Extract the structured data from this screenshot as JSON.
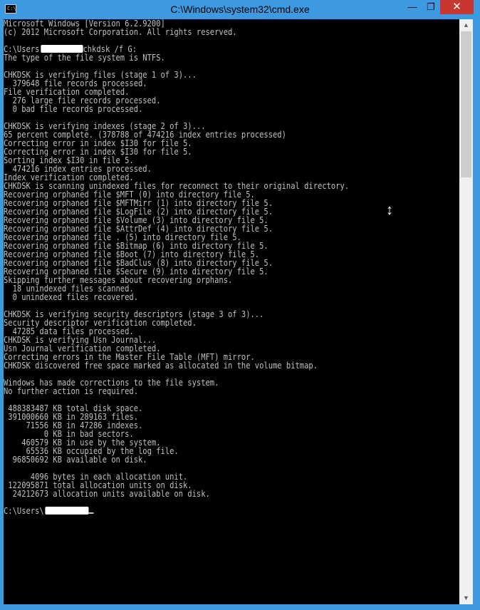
{
  "window": {
    "title": "C:\\Windows\\system32\\cmd.exe",
    "icon_name": "console-app-icon",
    "icon_label": "C:\\",
    "minimize_symbol": "—",
    "maximize_symbol": "❐",
    "close_symbol": "✕"
  },
  "console": {
    "lines": [
      {
        "text": "Microsoft Windows [Version 6.2.9200]"
      },
      {
        "text": "(c) 2012 Microsoft Corporation. All rights reserved."
      },
      {
        "text": ""
      },
      {
        "text": "C:\\Users",
        "redacted": true,
        "after": "chkdsk /f G:"
      },
      {
        "text": "The type of the file system is NTFS."
      },
      {
        "text": ""
      },
      {
        "text": "CHKDSK is verifying files (stage 1 of 3)..."
      },
      {
        "text": "  379648 file records processed."
      },
      {
        "text": "File verification completed."
      },
      {
        "text": "  276 large file records processed."
      },
      {
        "text": "  0 bad file records processed."
      },
      {
        "text": ""
      },
      {
        "text": "CHKDSK is verifying indexes (stage 2 of 3)..."
      },
      {
        "text": "65 percent complete. (378788 of 474216 index entries processed)"
      },
      {
        "text": "Correcting error in index $I30 for file 5."
      },
      {
        "text": "Correcting error in index $I30 for file 5."
      },
      {
        "text": "Sorting index $I30 in file 5."
      },
      {
        "text": "  474216 index entries processed."
      },
      {
        "text": "Index verification completed."
      },
      {
        "text": "CHKDSK is scanning unindexed files for reconnect to their original directory."
      },
      {
        "text": "Recovering orphaned file $MFT (0) into directory file 5."
      },
      {
        "text": "Recovering orphaned file $MFTMirr (1) into directory file 5."
      },
      {
        "text": "Recovering orphaned file $LogFile (2) into directory file 5."
      },
      {
        "text": "Recovering orphaned file $Volume (3) into directory file 5."
      },
      {
        "text": "Recovering orphaned file $AttrDef (4) into directory file 5."
      },
      {
        "text": "Recovering orphaned file . (5) into directory file 5."
      },
      {
        "text": "Recovering orphaned file $Bitmap (6) into directory file 5."
      },
      {
        "text": "Recovering orphaned file $Boot (7) into directory file 5."
      },
      {
        "text": "Recovering orphaned file $BadClus (8) into directory file 5."
      },
      {
        "text": "Recovering orphaned file $Secure (9) into directory file 5."
      },
      {
        "text": "Skipping further messages about recovering orphans."
      },
      {
        "text": "  18 unindexed files scanned."
      },
      {
        "text": "  0 unindexed files recovered."
      },
      {
        "text": ""
      },
      {
        "text": "CHKDSK is verifying security descriptors (stage 3 of 3)..."
      },
      {
        "text": "Security descriptor verification completed."
      },
      {
        "text": "  47285 data files processed."
      },
      {
        "text": "CHKDSK is verifying Usn Journal..."
      },
      {
        "text": "Usn Journal verification completed."
      },
      {
        "text": "Correcting errors in the Master File Table (MFT) mirror."
      },
      {
        "text": "CHKDSK discovered free space marked as allocated in the volume bitmap."
      },
      {
        "text": ""
      },
      {
        "text": "Windows has made corrections to the file system."
      },
      {
        "text": "No further action is required."
      },
      {
        "text": ""
      },
      {
        "text": " 488383487 KB total disk space."
      },
      {
        "text": " 391000660 KB in 289163 files."
      },
      {
        "text": "     71556 KB in 47286 indexes."
      },
      {
        "text": "         0 KB in bad sectors."
      },
      {
        "text": "    460579 KB in use by the system."
      },
      {
        "text": "     65536 KB occupied by the log file."
      },
      {
        "text": "  96850692 KB available on disk."
      },
      {
        "text": ""
      },
      {
        "text": "      4096 bytes in each allocation unit."
      },
      {
        "text": " 122095871 total allocation units on disk."
      },
      {
        "text": "  24212673 allocation units available on disk."
      },
      {
        "text": ""
      },
      {
        "text": "C:\\Users\\",
        "redacted": true,
        "after": "",
        "cursor": true
      }
    ]
  },
  "scrollbar": {
    "up_arrow": "▲",
    "down_arrow": "▼"
  },
  "mouse_cursor_symbol": "↕",
  "colors": {
    "title_bar": "#3e9ae0",
    "console_bg": "#000000",
    "console_text": "#c0c0c0",
    "close_button": "#c7372f"
  }
}
